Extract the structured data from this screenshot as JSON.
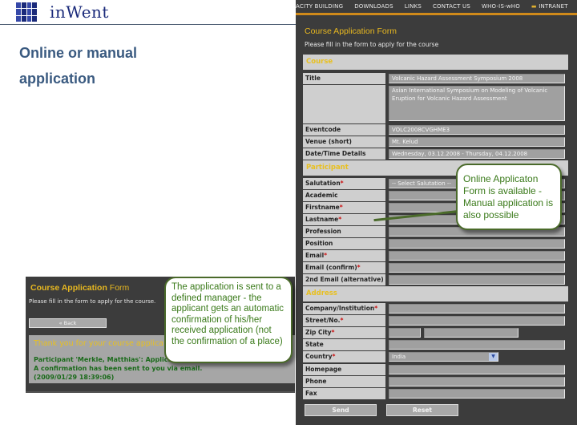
{
  "slide": {
    "logo_text": "inWent",
    "title_line1": "Online or manual",
    "title_line2": "application"
  },
  "online_form": {
    "nav": [
      {
        "label": "ACITY BUILDING"
      },
      {
        "label": "DOWNLOADS"
      },
      {
        "label": "LINKS"
      },
      {
        "label": "CONTACT US"
      },
      {
        "label": "WHO-IS-wHO"
      },
      {
        "label": "INTRANET",
        "icon": "lock-icon"
      }
    ],
    "title": "Course Application Form",
    "subtitle": "Please fill in the form to apply for the course",
    "sections": {
      "course": "Course",
      "participant": "Participant",
      "address": "Address"
    },
    "course_fields": {
      "title_label": "Title",
      "title_value": "Volcanic Hazard Assessment Symposium 2008",
      "description_value": "Asian International Symposium on Modeling of Volcanic Eruption for Volcanic Hazard Assessment",
      "eventcode_label": "Eventcode",
      "eventcode_value": "VOLC2008CVGHME3",
      "venue_label": "Venue (short)",
      "venue_value": "Mt. Kelud",
      "datetime_label": "Date/Time Details",
      "datetime_value": "Wednesday, 03.12.2008 - Thursday, 04.12.2008"
    },
    "participant_fields": [
      {
        "label": "Salutation",
        "required": "*",
        "value": "-- Select Salutation --"
      },
      {
        "label": "Academic",
        "required": "",
        "value": ""
      },
      {
        "label": "Firstname",
        "required": "*",
        "value": ""
      },
      {
        "label": "Lastname",
        "required": "*",
        "value": ""
      },
      {
        "label": "Profession",
        "required": "",
        "value": ""
      },
      {
        "label": "Position",
        "required": "",
        "value": ""
      },
      {
        "label": "Email",
        "required": "*",
        "value": ""
      },
      {
        "label": "Email (confirm)",
        "required": "*",
        "value": ""
      },
      {
        "label": "2nd Email (alternative)",
        "required": "",
        "value": ""
      }
    ],
    "address_fields": [
      {
        "label": "Company/Institution",
        "required": "*",
        "value": ""
      },
      {
        "label": "Street/No.",
        "required": "*",
        "value": ""
      },
      {
        "label": "Zip City",
        "required": "*",
        "zip": "",
        "city": ""
      },
      {
        "label": "State",
        "required": "",
        "value": ""
      },
      {
        "label": "Country",
        "required": "*",
        "value": "India"
      },
      {
        "label": "Homepage",
        "required": "",
        "value": ""
      },
      {
        "label": "Phone",
        "required": "",
        "value": ""
      },
      {
        "label": "Fax",
        "required": "",
        "value": ""
      }
    ],
    "send_label": "Send",
    "reset_label": "Reset"
  },
  "confirmation": {
    "title_bold": "Course Application",
    "title_plain": " Form",
    "subtitle": "Please fill in the form to apply for the course.",
    "back_label": "« Back",
    "thanks": "Thank you for your course application",
    "line1": "Participant 'Merkle, Matthias': Application",
    "line2": "A confirmation has been sent to you via email.",
    "line3": "(2009/01/29 18:39:06)"
  },
  "callouts": {
    "online": "Online Applicaton Form is available - Manual application is also possible",
    "manual": "The application is sent to a defined manager - the applicant gets an automatic confirmation of his/her received application (not the confirmation of a place)"
  }
}
